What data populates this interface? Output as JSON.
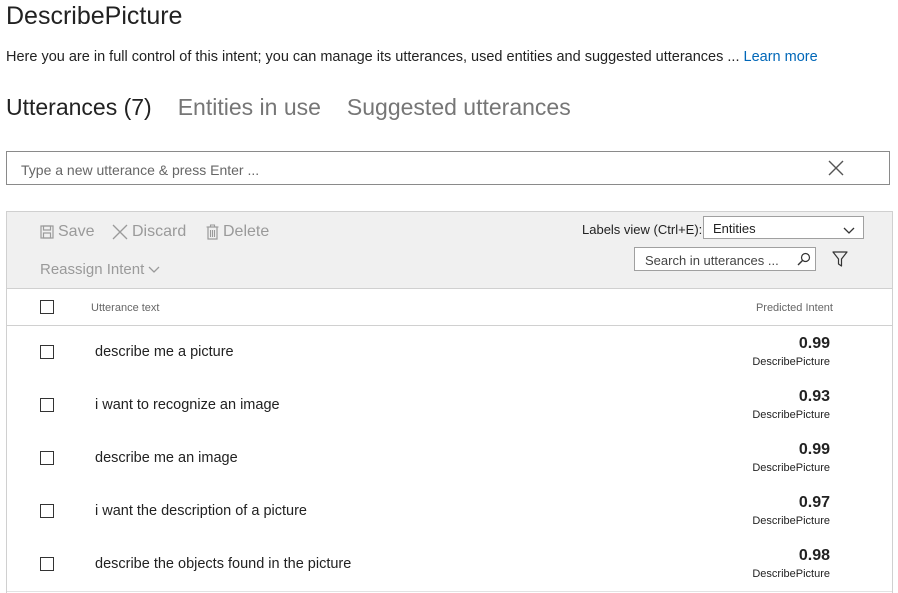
{
  "intent": {
    "title": "DescribePicture",
    "description": "Here you are in full control of this intent; you can manage its utterances, used entities and suggested utterances ... ",
    "learn_more": "Learn more"
  },
  "tabs": [
    {
      "label": "Utterances (7)",
      "active": true
    },
    {
      "label": "Entities in use",
      "active": false
    },
    {
      "label": "Suggested utterances",
      "active": false
    }
  ],
  "new_utterance": {
    "placeholder": "Type a new utterance & press Enter ..."
  },
  "toolbar": {
    "save": "Save",
    "discard": "Discard",
    "delete": "Delete",
    "reassign": "Reassign Intent",
    "labels_view_label": "Labels view (Ctrl+E):",
    "labels_view_value": "Entities",
    "search_placeholder": "Search in utterances ..."
  },
  "table": {
    "col_text": "Utterance text",
    "col_intent": "Predicted Intent",
    "rows": [
      {
        "text": "describe me a picture",
        "score": "0.99",
        "intent": "DescribePicture"
      },
      {
        "text": "i want to recognize an image",
        "score": "0.93",
        "intent": "DescribePicture"
      },
      {
        "text": "describe me an image",
        "score": "0.99",
        "intent": "DescribePicture"
      },
      {
        "text": "i want the description of a picture",
        "score": "0.97",
        "intent": "DescribePicture"
      },
      {
        "text": "describe the objects found in the picture",
        "score": "0.98",
        "intent": "DescribePicture"
      }
    ]
  }
}
